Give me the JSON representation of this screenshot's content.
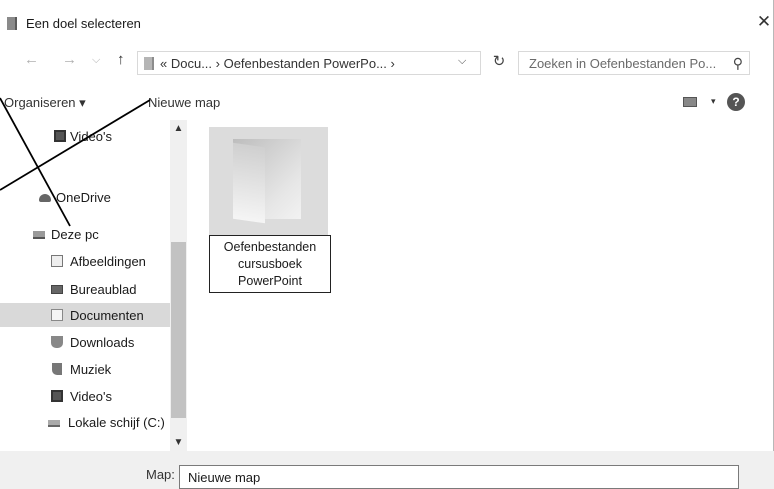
{
  "window": {
    "title": "Een doel selecteren",
    "close_symbol": "✕"
  },
  "nav": {
    "back_symbol": "←",
    "forward_symbol": "→",
    "recent_symbol": "⌵",
    "up_symbol": "↑",
    "address_text": "« Docu...  ›  Oefenbestanden PowerPo...  ›",
    "address_dropdown_symbol": "⌵",
    "refresh_symbol": "↻",
    "search_placeholder": "Zoeken in Oefenbestanden Po...",
    "search_icon": "⚲"
  },
  "toolbar": {
    "organise_label": "Organiseren ▾",
    "new_folder_label": "Nieuwe map",
    "view_arrow": "▾",
    "help_symbol": "?"
  },
  "navpane": {
    "items": [
      {
        "label": "Video's",
        "icon": "video-icon"
      },
      {
        "label": "OneDrive",
        "icon": "onedrive-icon"
      },
      {
        "label": "Deze pc",
        "icon": "computer-icon"
      },
      {
        "label": "Afbeeldingen",
        "icon": "pictures-icon"
      },
      {
        "label": "Bureaublad",
        "icon": "desktop-icon"
      },
      {
        "label": "Documenten",
        "icon": "documents-icon",
        "selected": true
      },
      {
        "label": "Downloads",
        "icon": "downloads-icon"
      },
      {
        "label": "Muziek",
        "icon": "music-icon"
      },
      {
        "label": "Video's",
        "icon": "video-icon"
      },
      {
        "label": "Lokale schijf (C:)",
        "icon": "drive-icon"
      }
    ],
    "scroll_up_symbol": "▲",
    "scroll_down_symbol": "▼"
  },
  "content": {
    "folder_name_lines": [
      "Oefenbestanden",
      "cursusboek",
      "PowerPoint"
    ]
  },
  "footer": {
    "map_label": "Map:",
    "map_value": "Nieuwe map"
  },
  "colors": {
    "selection": "#d9d9d9",
    "footer_bg": "#f0f0f0",
    "annotation": "#000000"
  }
}
